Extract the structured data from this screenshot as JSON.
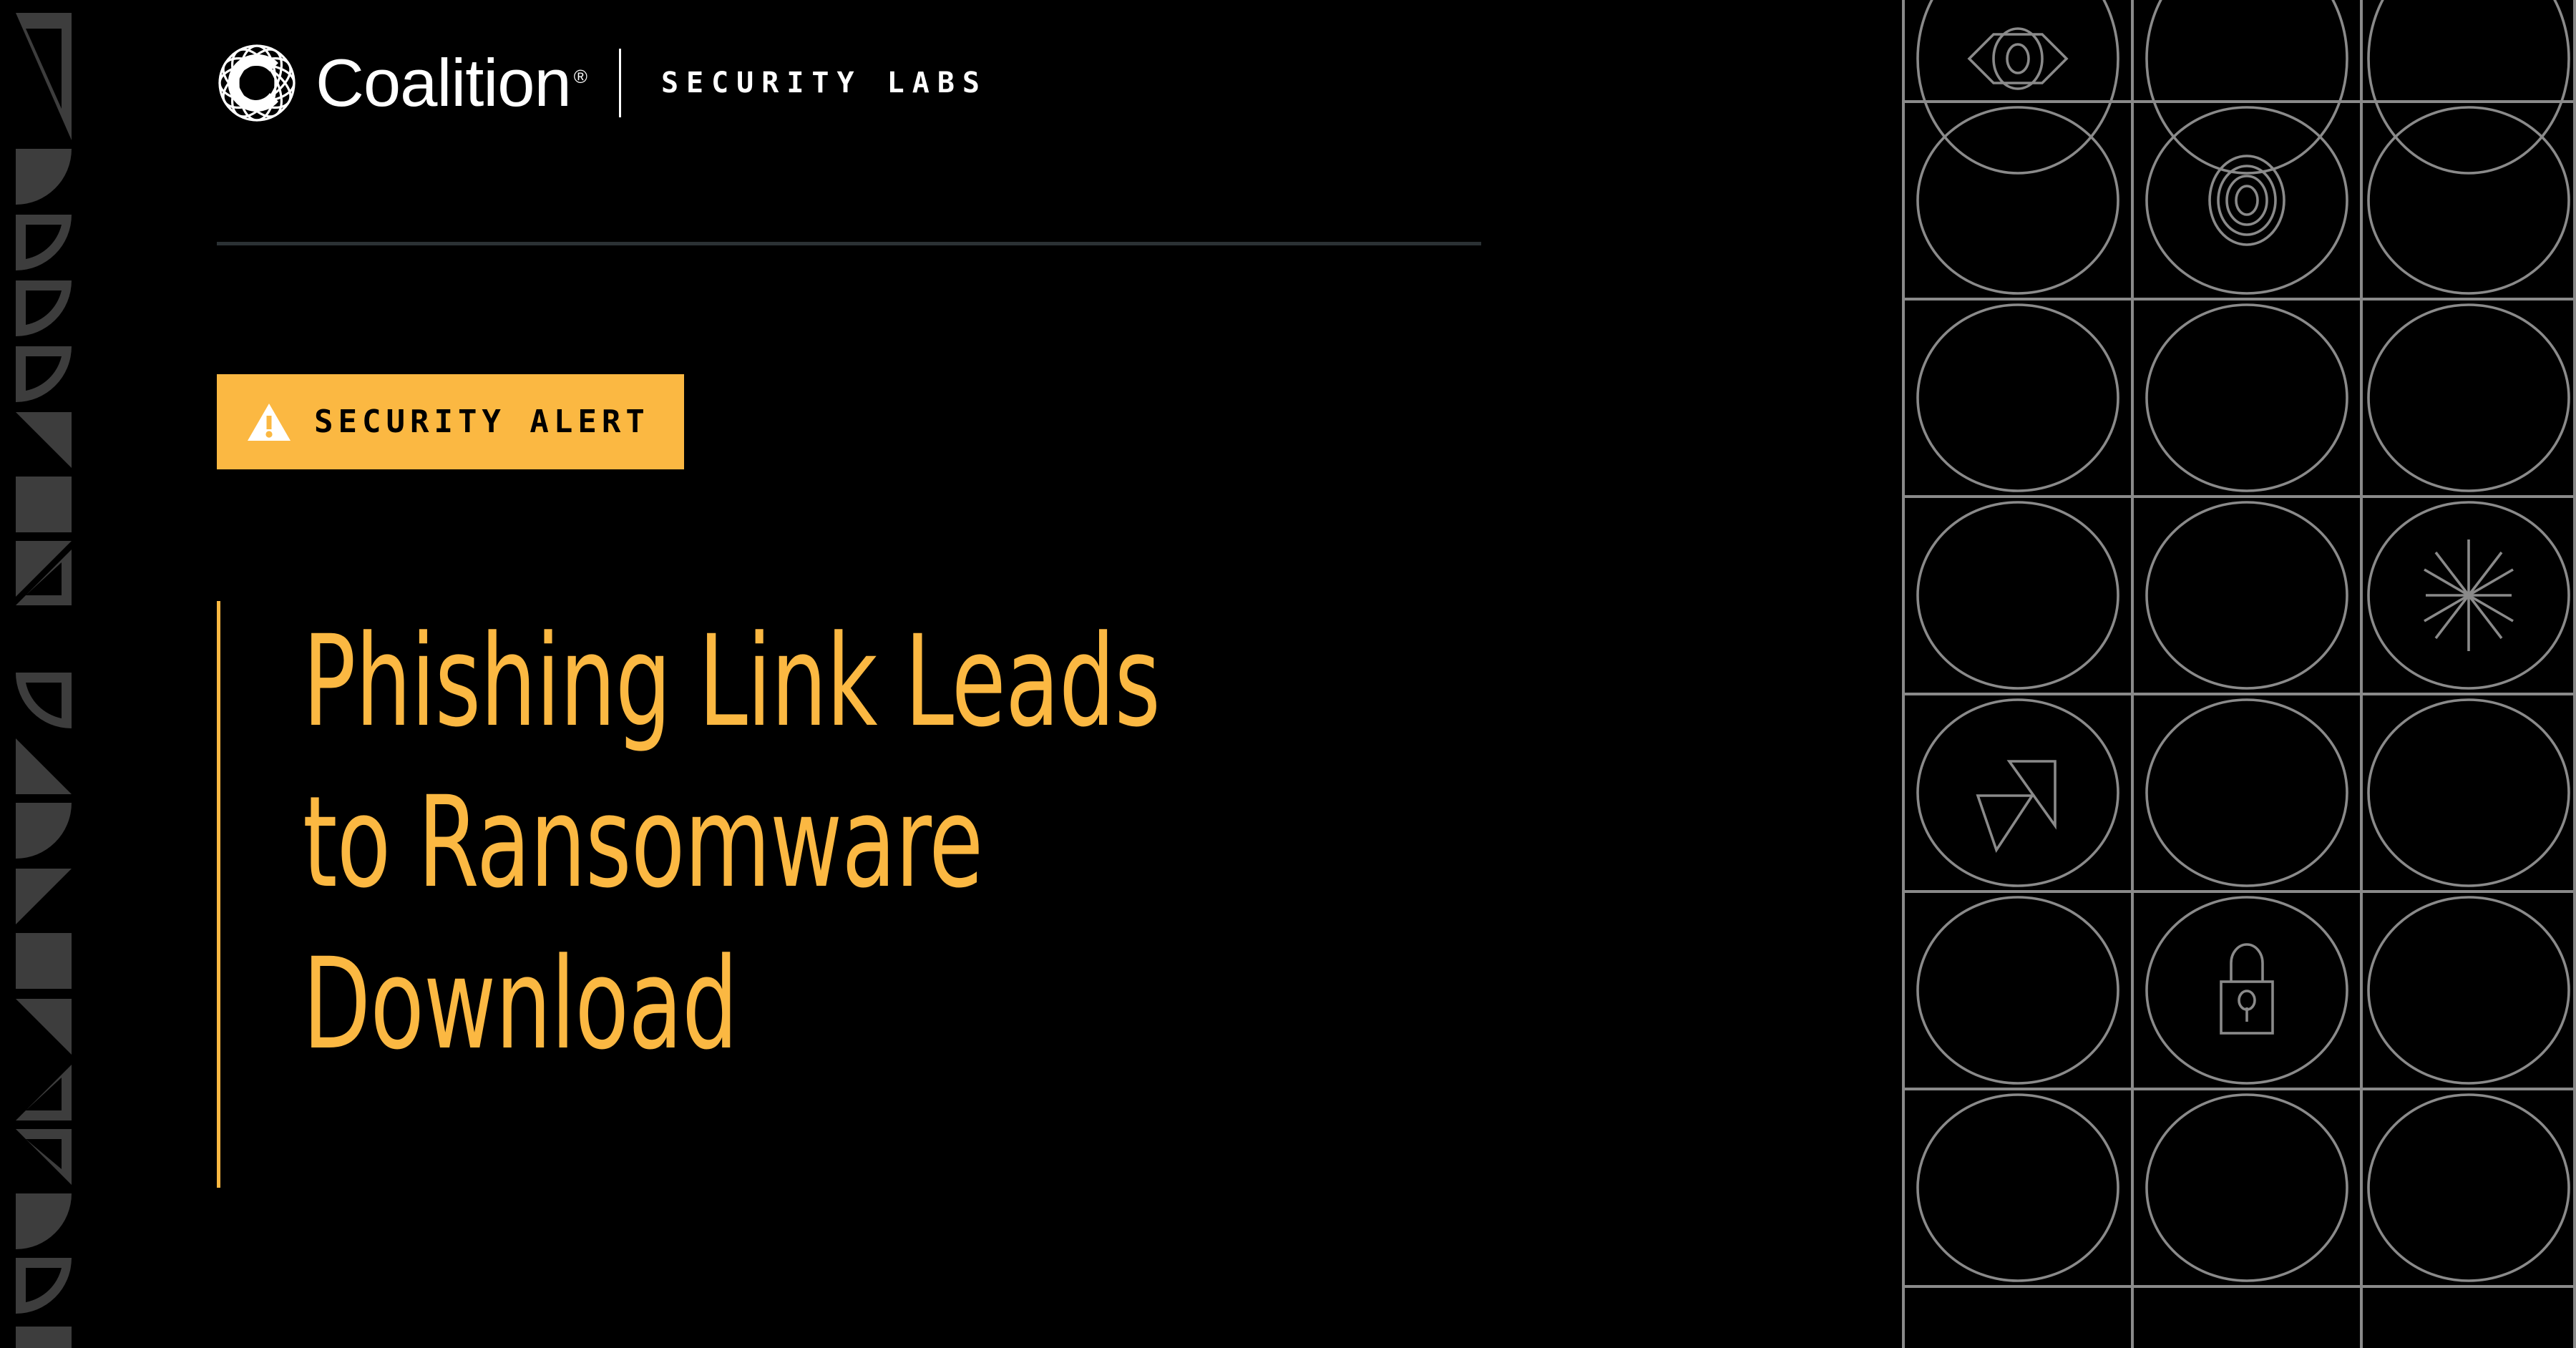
{
  "colors": {
    "background": "#000000",
    "accent_amber": "#fbb842",
    "white": "#ffffff",
    "divider_gray": "#2b3134",
    "grid_line_gray": "#8a8a8a",
    "left_pattern_gray": "#3d3d3d",
    "badge_text": "#000000"
  },
  "header": {
    "logo_icon": "coalition-globe-c-logo",
    "brand_name": "Coalition",
    "registered_mark": "®",
    "divider_icon": "vertical-pipe-divider",
    "sub_brand": "SECURITY LABS"
  },
  "divider": {
    "name": "horizontal-rule"
  },
  "alert": {
    "icon": "warning-triangle-icon",
    "label": "SECURITY ALERT"
  },
  "headline": {
    "accent_rule": "vertical-accent-rule",
    "text": "Phishing Link Leads\nto Ransomware\nDownload",
    "line_1": "Phishing Link Leads",
    "line_2": "to Ransomware",
    "line_3": "Download"
  },
  "decor": {
    "left_strip_name": "geometric-shape-strip",
    "left_strip_shapes": [
      "triangle-outline-down-right",
      "quarter-circle-filled",
      "quarter-circle-outline",
      "quarter-circle-outline",
      "quarter-circle-outline",
      "triangle-filled-down-right",
      "square-filled",
      "rect-filled-short",
      "triangle-filled-up-right",
      "triangle-outline-up-right",
      "quarter-circle-outline-left",
      "triangle-filled-up-right",
      "quarter-circle-filled",
      "triangle-filled-down-right",
      "square-filled",
      "triangle-filled-up-right",
      "triangle-outline-up-right",
      "triangle-outline-down-right",
      "quarter-circle-filled",
      "quarter-circle-outline"
    ]
  },
  "icon_grid": {
    "name": "circle-icon-grid",
    "columns": 3,
    "rows": 6,
    "cells": [
      {
        "row": 1,
        "col": 1,
        "icon": "eye-icon"
      },
      {
        "row": 1,
        "col": 2,
        "icon": "empty-circle"
      },
      {
        "row": 1,
        "col": 3,
        "icon": "empty-circle"
      },
      {
        "row": 2,
        "col": 1,
        "icon": "empty-circle"
      },
      {
        "row": 2,
        "col": 2,
        "icon": "concentric-rings-icon"
      },
      {
        "row": 2,
        "col": 3,
        "icon": "empty-circle"
      },
      {
        "row": 3,
        "col": 1,
        "icon": "empty-circle"
      },
      {
        "row": 3,
        "col": 2,
        "icon": "empty-circle"
      },
      {
        "row": 3,
        "col": 3,
        "icon": "starburst-icon"
      },
      {
        "row": 4,
        "col": 1,
        "icon": "triangles-send-icon"
      },
      {
        "row": 4,
        "col": 2,
        "icon": "empty-circle"
      },
      {
        "row": 4,
        "col": 3,
        "icon": "empty-circle"
      },
      {
        "row": 5,
        "col": 1,
        "icon": "empty-circle"
      },
      {
        "row": 5,
        "col": 2,
        "icon": "padlock-icon"
      },
      {
        "row": 5,
        "col": 3,
        "icon": "empty-circle"
      },
      {
        "row": 6,
        "col": 1,
        "icon": "empty-circle"
      },
      {
        "row": 6,
        "col": 2,
        "icon": "empty-circle"
      },
      {
        "row": 6,
        "col": 3,
        "icon": "empty-circle"
      }
    ]
  }
}
